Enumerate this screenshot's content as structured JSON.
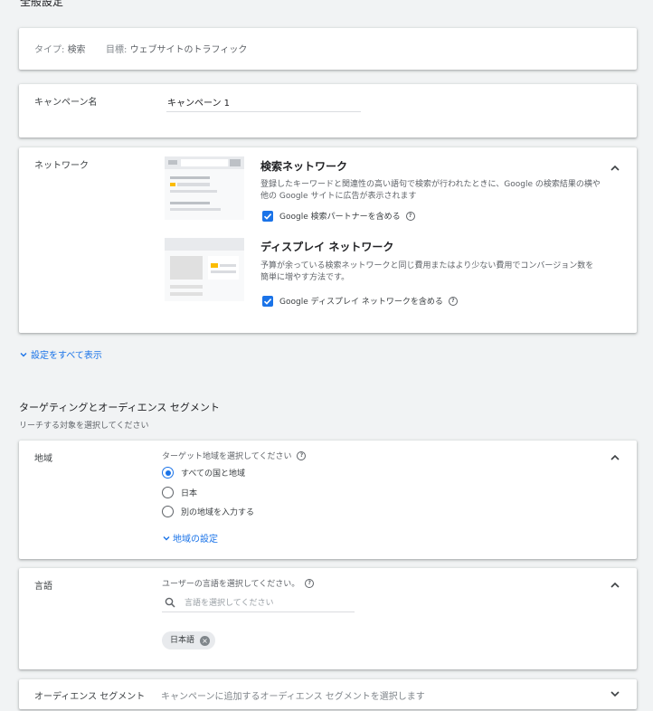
{
  "general": {
    "title": "全般設定",
    "type_label": "タイプ:",
    "type_value": "検索",
    "goal_label": "目標:",
    "goal_value": "ウェブサイトのトラフィック"
  },
  "campaign_name": {
    "label": "キャンペーン名",
    "value": "キャンペーン 1"
  },
  "network": {
    "label": "ネットワーク",
    "search": {
      "title": "検索ネットワーク",
      "desc_line1": "登録したキーワードと関連性の高い語句で検索が行われたときに、Google の検索結果の横や",
      "desc_line2": "他の Google サイトに広告が表示されます",
      "checkbox_label": "Google 検索パートナーを含める"
    },
    "display": {
      "title": "ディスプレイ ネットワーク",
      "desc_line1": "予算が余っている検索ネットワークと同じ費用またはより少ない費用でコンバージョン数を",
      "desc_line2": "簡単に増やす方法です。",
      "checkbox_label": "Google ディスプレイ ネットワークを含める"
    }
  },
  "show_all_settings": "設定をすべて表示",
  "targeting": {
    "title": "ターゲティングとオーディエンス セグメント",
    "subtitle": "リーチする対象を選択してください"
  },
  "location": {
    "label": "地域",
    "prompt": "ターゲット地域を選択してください",
    "options": [
      "すべての国と地域",
      "日本",
      "別の地域を入力する"
    ],
    "selected_index": 0,
    "settings_link": "地域の設定"
  },
  "language": {
    "label": "言語",
    "prompt": "ユーザーの言語を選択してください。",
    "search_placeholder": "言語を選択してください",
    "chip": "日本語"
  },
  "audience": {
    "label": "オーディエンス セグメント",
    "prompt": "キャンペーンに追加するオーディエンス セグメントを選択します"
  },
  "colors": {
    "accent": "#1a73e8",
    "background": "#f1f3f4",
    "card": "#ffffff",
    "illustration_yellow": "#fbbc04"
  }
}
